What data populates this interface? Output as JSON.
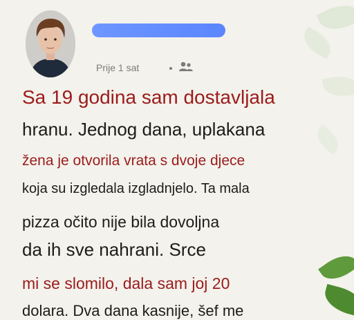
{
  "post": {
    "time": "Prije 1 sat",
    "audience_icon": "people-icon",
    "name_redacted_color": "#5a86ff",
    "text_lines": [
      "Sa 19 godina sam dostavljala",
      "hranu. Jednog dana, uplakana",
      "žena je otvorila vrata s dvoje djece",
      "koja su izgledala izgladnjelo. Ta mala",
      "pizza očito nije bila dovoljna",
      "da ih sve nahrani. Srce",
      "mi se slomilo, dala sam joj 20",
      "dolara. Dva dana kasnije, šef me"
    ]
  },
  "colors": {
    "background": "#f3f2ec",
    "accent_red": "#9b1b1b",
    "text": "#1c1c1c"
  }
}
